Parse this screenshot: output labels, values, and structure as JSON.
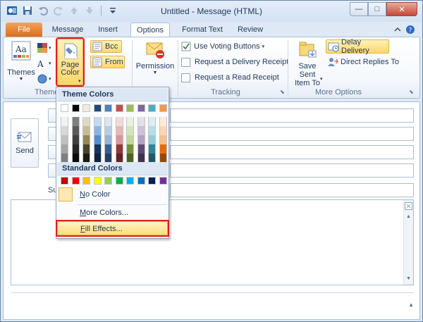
{
  "window": {
    "title": "Untitled - Message (HTML)",
    "close_glyph": "✕",
    "min_glyph": "—",
    "max_glyph": "□"
  },
  "qat": {
    "icons": [
      "outlook-icon",
      "save-icon",
      "undo-icon",
      "redo-icon",
      "up-arrow-icon",
      "down-arrow-icon",
      "customize-icon"
    ]
  },
  "tabs": {
    "file": "File",
    "message": "Message",
    "insert": "Insert",
    "options": "Options",
    "format_text": "Format Text",
    "review": "Review"
  },
  "ribbon": {
    "themes_label": "Themes",
    "page_color_line1": "Page",
    "page_color_line2": "Color",
    "bcc_label": "Bcc",
    "from_label": "From",
    "themes_group_label": "Themes",
    "permission_label": "Permission",
    "tracking": {
      "use_voting_buttons": "Use Voting Buttons",
      "request_delivery_receipt": "Request a Delivery Receipt",
      "request_read_receipt": "Request a Read Receipt",
      "group_label": "Tracking"
    },
    "more_options": {
      "save_sent_line1": "Save Sent",
      "save_sent_line2": "Item To",
      "delay_delivery": "Delay Delivery",
      "direct_replies": "Direct Replies To",
      "group_label": "More Options"
    }
  },
  "compose": {
    "send_label": "Send",
    "subject_label": "Su"
  },
  "dropdown": {
    "theme_colors_header": "Theme Colors",
    "standard_colors_header": "Standard Colors",
    "no_color_label": "No Color",
    "no_color_hotkey": "N",
    "more_colors_label": "More Colors...",
    "more_colors_hotkey": "M",
    "fill_effects_label": "Fill Effects...",
    "fill_effects_hotkey": "F",
    "theme_top_row": [
      "#ffffff",
      "#000000",
      "#eeece1",
      "#1f497d",
      "#4f81bd",
      "#c0504d",
      "#9bbb59",
      "#8064a2",
      "#4bacc6",
      "#f79646"
    ],
    "theme_shades": [
      [
        "#f2f2f2",
        "#d8d8d8",
        "#bfbfbf",
        "#a5a5a5",
        "#7f7f7f"
      ],
      [
        "#7f7f7f",
        "#595959",
        "#3f3f3f",
        "#262626",
        "#0c0c0c"
      ],
      [
        "#ddd9c3",
        "#c4bd97",
        "#938953",
        "#494429",
        "#1d1b10"
      ],
      [
        "#c6d9f0",
        "#8db3e2",
        "#548dd4",
        "#17365d",
        "#0f243e"
      ],
      [
        "#dbe5f1",
        "#b8cce4",
        "#95b3d7",
        "#366092",
        "#244061"
      ],
      [
        "#f2dcdb",
        "#e5b9b7",
        "#d99694",
        "#953734",
        "#632423"
      ],
      [
        "#ebf1dd",
        "#d7e3bc",
        "#c3d69b",
        "#76923c",
        "#4f6128"
      ],
      [
        "#e5e0ec",
        "#ccc1d9",
        "#b2a2c7",
        "#5f497a",
        "#3f3151"
      ],
      [
        "#dbeef3",
        "#b7dde8",
        "#92cddc",
        "#31859b",
        "#205867"
      ],
      [
        "#fdeada",
        "#fbd5b5",
        "#fac08f",
        "#e36c09",
        "#974806"
      ]
    ],
    "standard_row": [
      "#c00000",
      "#ff0000",
      "#ffc000",
      "#ffff00",
      "#92d050",
      "#00b050",
      "#00b0f0",
      "#0070c0",
      "#002060",
      "#7030a0"
    ]
  }
}
